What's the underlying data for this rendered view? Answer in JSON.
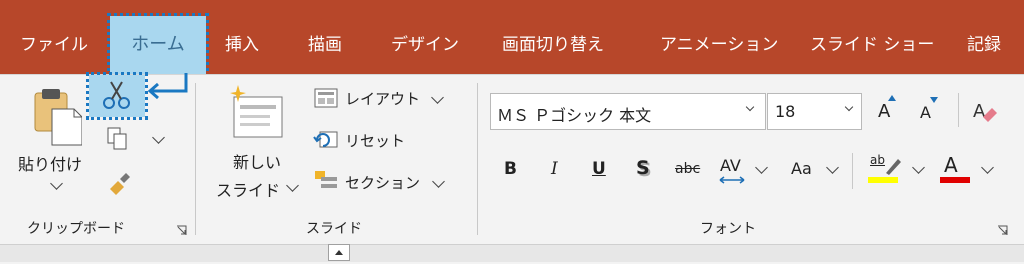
{
  "tabs": [
    {
      "label": "ファイル"
    },
    {
      "label": "ホーム"
    },
    {
      "label": "挿入"
    },
    {
      "label": "描画"
    },
    {
      "label": "デザイン"
    },
    {
      "label": "画面切り替え"
    },
    {
      "label": "アニメーション"
    },
    {
      "label": "スライド ショー"
    },
    {
      "label": "記録"
    }
  ],
  "clipboard": {
    "paste_line1": "貼り付け",
    "group_label": "クリップボード"
  },
  "slides": {
    "new_slide_line1": "新しい",
    "new_slide_line2": "スライド",
    "layout": "レイアウト",
    "reset": "リセット",
    "section": "セクション",
    "group_label": "スライド"
  },
  "font": {
    "font_name": "ＭＳ Ｐゴシック 本文",
    "font_size": "18",
    "bold": "B",
    "italic": "I",
    "underline": "U",
    "shadow": "S",
    "strike": "abc",
    "spacing": "AV",
    "case": "Aa",
    "grow": "A",
    "shrink": "A",
    "highlight": "ab",
    "color": "A",
    "group_label": "フォント"
  },
  "colors": {
    "tab_bar": "#b7472a",
    "active_tab": "#a9d7ef",
    "highlight_annotation": "#1a78c2",
    "highlighter_yellow": "#ffff00",
    "font_color_red": "#e00000"
  }
}
